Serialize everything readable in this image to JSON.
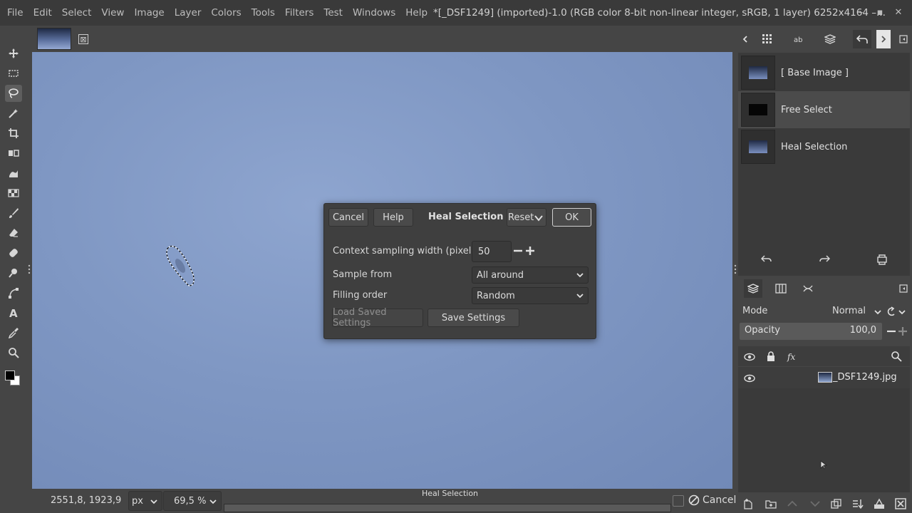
{
  "menu": [
    "File",
    "Edit",
    "Select",
    "View",
    "Image",
    "Layer",
    "Colors",
    "Tools",
    "Filters",
    "Test",
    "Windows",
    "Help"
  ],
  "window": {
    "title": "*[_DSF1249] (imported)-1.0 (RGB color 8-bit non-linear integer, sRGB, 1 layer) 6252x4164 –...",
    "minimize": "–",
    "maximize": "▪",
    "close": "✕"
  },
  "tab": {
    "close_glyph": "⊠"
  },
  "dialog": {
    "cancel": "Cancel",
    "help": "Help",
    "title": "Heal Selection",
    "reset": "Reset",
    "ok": "OK",
    "context_label": "Context sampling width (pixels)",
    "context_value": "50",
    "sample_label": "Sample from",
    "sample_value": "All around",
    "filling_label": "Filling order",
    "filling_value": "Random",
    "load_settings": "Load Saved Settings",
    "save_settings": "Save Settings"
  },
  "status": {
    "coords": "2551,8, 1923,9",
    "unit": "px",
    "zoom": "69,5 %",
    "message": "Heal Selection",
    "cancel": "Cancel",
    "progress": 0.0
  },
  "undo_history": [
    {
      "label": "[ Base Image ]"
    },
    {
      "label": "Free Select"
    },
    {
      "label": "Heal Selection"
    }
  ],
  "layers": {
    "mode_label": "Mode",
    "mode_value": "Normal",
    "opacity_label": "Opacity",
    "opacity_value": "100,0",
    "layer_name": "_DSF1249.jpg"
  }
}
